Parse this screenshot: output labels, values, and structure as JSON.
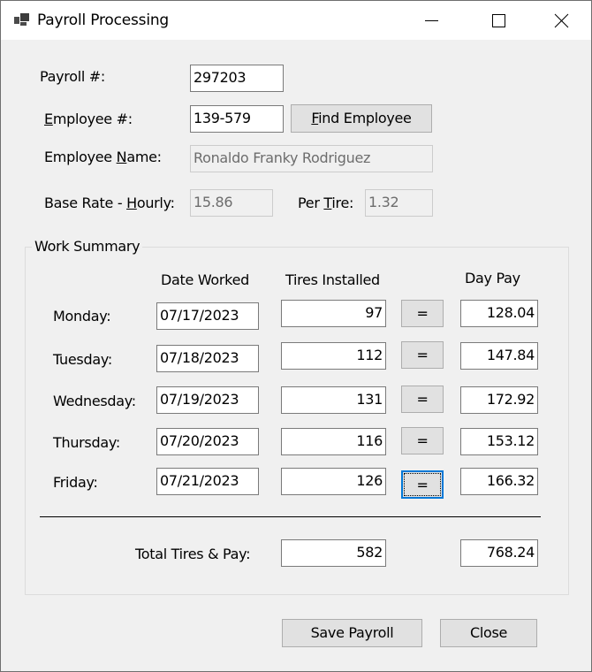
{
  "window": {
    "title": "Payroll Processing",
    "app_icon": "app-window-icon",
    "controls": {
      "minimize_icon": "minimize-icon",
      "maximize_icon": "maximize-icon",
      "close_icon": "close-icon"
    }
  },
  "header": {
    "payroll_label": "Payroll #:",
    "payroll_number": "297203",
    "employee_label_mnemonic": "E",
    "employee_label_rest": "mployee #:",
    "employee_number": "139-579",
    "find_button_mnemonic": "F",
    "find_button_rest": "ind Employee",
    "name_label_pre": "Employee ",
    "name_label_mnemonic": "N",
    "name_label_rest": "ame:",
    "employee_name": "Ronaldo Franky Rodriguez",
    "base_rate_label_pre": "Base Rate - ",
    "base_rate_label_mnemonic": "H",
    "base_rate_label_rest": "ourly:",
    "base_rate_hourly": "15.86",
    "per_tire_label_pre": "Per ",
    "per_tire_label_mnemonic": "T",
    "per_tire_label_rest": "ire:",
    "per_tire": "1.32"
  },
  "work_summary": {
    "title": "Work Summary",
    "columns": {
      "date": "Date Worked",
      "tires": "Tires Installed",
      "pay": "Day Pay"
    },
    "calc_button_label": "=",
    "days": [
      {
        "label": "Monday:",
        "date": "07/17/2023",
        "tires": "97",
        "pay": "128.04"
      },
      {
        "label": "Tuesday:",
        "date": "07/18/2023",
        "tires": "112",
        "pay": "147.84"
      },
      {
        "label": "Wednesday:",
        "date": "07/19/2023",
        "tires": "131",
        "pay": "172.92"
      },
      {
        "label": "Thursday:",
        "date": "07/20/2023",
        "tires": "116",
        "pay": "153.12"
      },
      {
        "label": "Friday:",
        "date": "07/21/2023",
        "tires": "126",
        "pay": "166.32"
      }
    ],
    "total_label": "Total Tires & Pay:",
    "total_tires": "582",
    "total_pay": "768.24"
  },
  "footer": {
    "save_label": "Save Payroll",
    "close_label": "Close"
  }
}
